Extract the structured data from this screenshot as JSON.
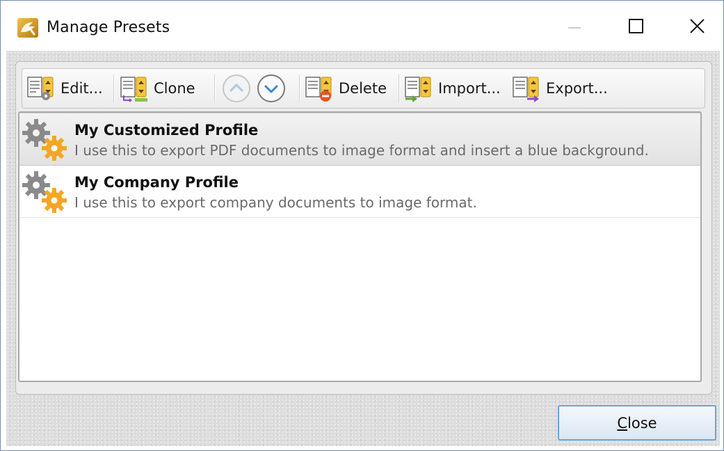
{
  "window": {
    "title": "Manage Presets",
    "controls": [
      "minimize-icon",
      "maximize-icon",
      "close-icon"
    ]
  },
  "toolbar": {
    "edit_label": "Edit...",
    "clone_label": "Clone",
    "move_up_icon": "chevron-up-circle-icon",
    "move_down_icon": "chevron-down-circle-icon",
    "delete_label": "Delete",
    "import_label": "Import...",
    "export_label": "Export..."
  },
  "presets": [
    {
      "title": "My Customized Profile",
      "description": "I use this to export PDF documents to image format and insert a blue background.",
      "icon": "gears-icon",
      "selected": true
    },
    {
      "title": "My Company Profile",
      "description": "I use this to export company documents to image format.",
      "icon": "gears-icon",
      "selected": false
    }
  ],
  "footer": {
    "close_mnemonic": "C",
    "close_rest": "lose"
  },
  "colors": {
    "close_button_border": "#64a7e0",
    "gear_gray": "#8a8a8a",
    "gear_orange": "#f5a623",
    "delete_red": "#e8502a",
    "import_green": "#5aa832",
    "export_purple": "#8a4fc4"
  }
}
